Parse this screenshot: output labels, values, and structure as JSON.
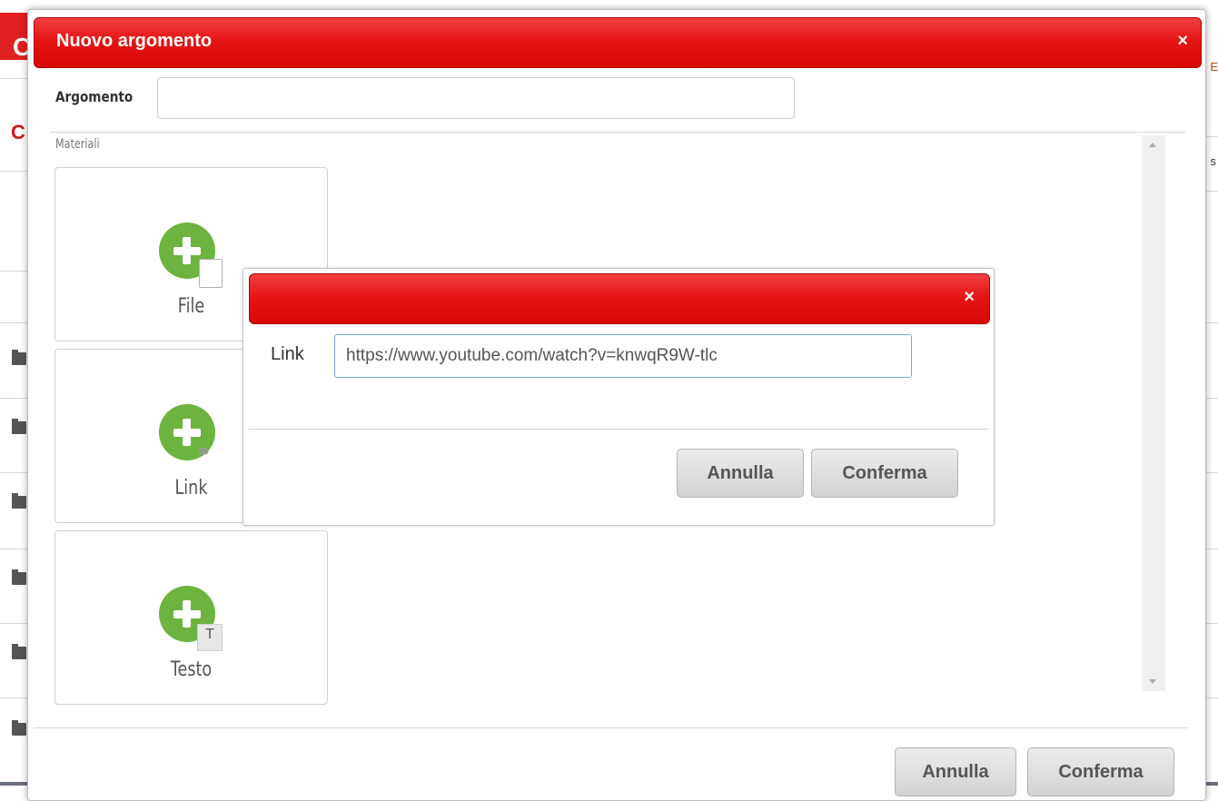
{
  "background": {
    "logo_letter": "C",
    "left_letter": "C",
    "right_text_1": "E",
    "right_text_2": "s"
  },
  "dialog": {
    "title": "Nuovo argomento",
    "close_glyph": "×",
    "argomento_label": "Argomento",
    "argomento_value": "",
    "materiali_label": "Materiali",
    "tiles": [
      {
        "label": "File",
        "icon": "add-file-icon"
      },
      {
        "label": "Link",
        "icon": "add-link-icon"
      },
      {
        "label": "Testo",
        "icon": "add-text-icon"
      }
    ],
    "cancel_label": "Annulla",
    "confirm_label": "Conferma"
  },
  "link_dialog": {
    "close_glyph": "×",
    "link_label": "Link",
    "link_value": "https://www.youtube.com/watch?v=knwqR9W-tlc",
    "cancel_label": "Annulla",
    "confirm_label": "Conferma"
  },
  "colors": {
    "header_red": "#e51515",
    "plus_green": "#6db33f",
    "input_focus_border": "#7aa6d6"
  }
}
